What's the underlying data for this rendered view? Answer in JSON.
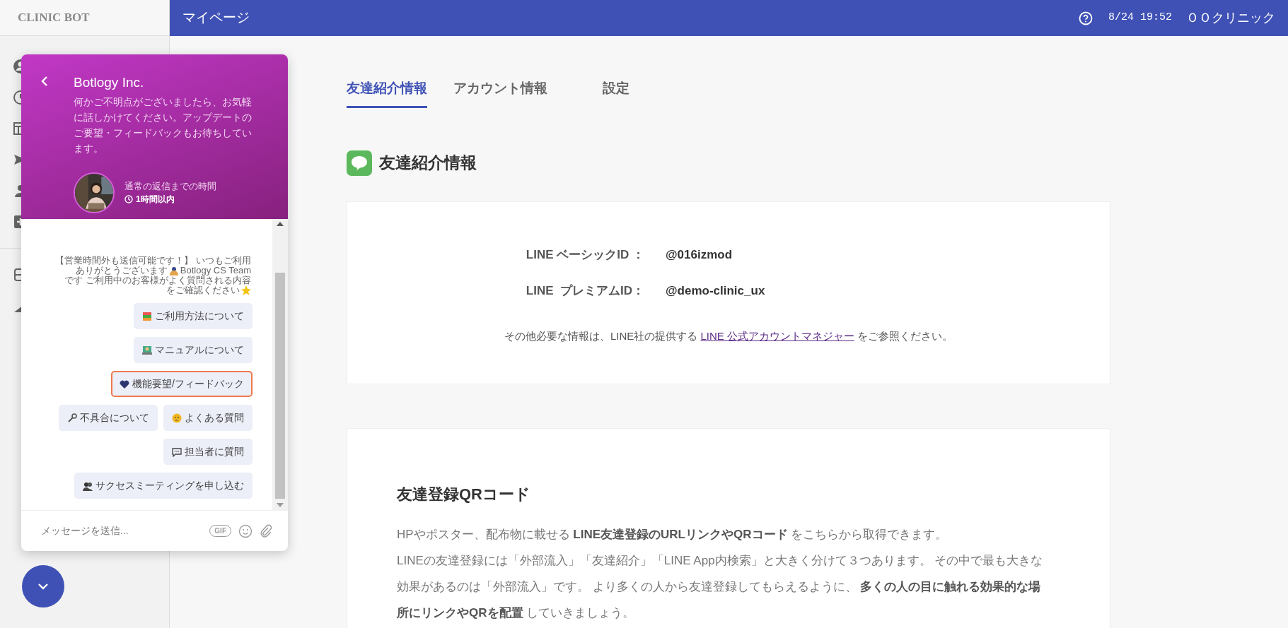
{
  "sidebar": {
    "brand": "CLINIC BOT"
  },
  "topbar": {
    "title": "マイページ",
    "datetime": "8/24 19:52",
    "clinic": "ＯＯクリニック"
  },
  "tabs": [
    {
      "label": "友達紹介情報",
      "selected": true
    },
    {
      "label": "アカウント情報",
      "selected": false
    },
    {
      "label": "設定",
      "selected": false
    }
  ],
  "section_title": "友達紹介情報",
  "ids": [
    {
      "label": "LINE ベーシックID ：",
      "value": "@016izmod"
    },
    {
      "label": "LINE  プレミアムID：",
      "value": "@demo-clinic_ux"
    }
  ],
  "note": {
    "before": "その他必要な情報は、LINE社の提供する",
    "link": "LINE 公式アカウントマネジャー",
    "after": "をご参照ください。"
  },
  "qr_card": {
    "title": "友達登録QRコード",
    "paragraphs": [
      "HPやポスター、配布物に載せる **LINE友達登録のURLリンクやQRコード** をこちらから取得できます。",
      "LINEの友達登録には「外部流入」「友達紹介」「LINE App内検索」と大きく分けて３つあります。 その中で最も大きな効果があるのは「外部流入」です。 より多くの人から友達登録してもらえるように、 **多くの人の目に触れる効果的な場所にリンクやQRを配置** していきましょう。"
    ]
  },
  "chat": {
    "company": "Botlogy Inc.",
    "description": "何かご不明点がございましたら、お気軽に話しかけてください。アップデートのご要望・フィードバックもお待ちしています。",
    "reply_label": "通常の返信までの時間",
    "reply_time": "1時間以内",
    "message_lines": [
      {
        "parts": [
          {
            "kind": "text",
            "text": "【営業時間外も送信可能です！】 いつもご利用"
          }
        ]
      },
      {
        "parts": [
          {
            "kind": "text",
            "text": "ありがとうございます"
          },
          {
            "kind": "bow"
          },
          {
            "kind": "text",
            "text": "Botlogy CS Team"
          }
        ]
      },
      {
        "parts": [
          {
            "kind": "text",
            "text": "です ご利用中のお客様がよく質問される内容"
          }
        ]
      },
      {
        "parts": [
          {
            "kind": "text",
            "text": "をご確認ください"
          },
          {
            "kind": "star"
          }
        ]
      }
    ],
    "quick_reply_rows": [
      {
        "buttons": [
          {
            "kind": "books",
            "label": "ご利用方法について",
            "highlighted": false
          }
        ]
      },
      {
        "buttons": [
          {
            "kind": "laptop",
            "label": "マニュアルについて",
            "highlighted": false
          }
        ]
      },
      {
        "buttons": [
          {
            "kind": "heart",
            "label": "機能要望/フィードバック",
            "highlighted": true
          }
        ]
      },
      {
        "buttons": [
          {
            "kind": "wrench",
            "label": "不具合について",
            "highlighted": false
          },
          {
            "kind": "face",
            "label": "よくある質問",
            "highlighted": false
          }
        ]
      },
      {
        "buttons": [
          {
            "kind": "speech",
            "label": "担当者に質問",
            "highlighted": false
          }
        ]
      },
      {
        "buttons": [
          {
            "kind": "people",
            "label": "サクセスミーティングを申し込む",
            "highlighted": false
          }
        ]
      }
    ],
    "input": {
      "placeholder": "メッセージを送信..."
    },
    "gif": "GIF"
  }
}
